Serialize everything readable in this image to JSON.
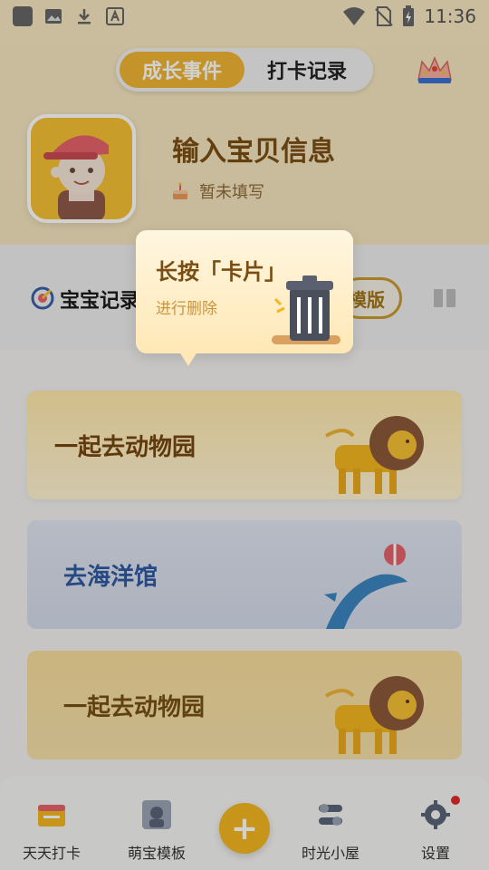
{
  "status_bar": {
    "time": "11:36",
    "icons": [
      "app-icon",
      "image-icon",
      "download-icon",
      "font-icon",
      "wifi-icon",
      "no-sim-icon",
      "battery-icon"
    ]
  },
  "header": {
    "tabs": [
      {
        "label": "成长事件",
        "active": true
      },
      {
        "label": "打卡记录",
        "active": false
      }
    ],
    "crown_icon": "crown-icon",
    "baby": {
      "name": "输入宝贝信息",
      "birthday_text": "暂未填写",
      "cake_icon": "cake-icon"
    }
  },
  "middle_bar": {
    "title": "宝宝记录",
    "pill_label": "模版",
    "icons": [
      "record-icon",
      "grid-icon"
    ]
  },
  "tooltip": {
    "title": "长按「卡片」",
    "subtitle": "进行删除",
    "icon": "trash-icon"
  },
  "cards": [
    {
      "label": "一起去动物园",
      "icon": "lion-icon",
      "color": "#fff4d2"
    },
    {
      "label": "去海洋馆",
      "icon": "dolphin-icon",
      "color": "#d3dae9"
    },
    {
      "label": "一起去动物园",
      "icon": "lion-icon",
      "color": "#f6e0a9"
    }
  ],
  "bottom_nav": {
    "items": [
      {
        "label": "天天打卡",
        "icon": "calendar-card-icon"
      },
      {
        "label": "萌宝模板",
        "icon": "baby-photo-icon"
      },
      {
        "label": "时光小屋",
        "icon": "toggles-icon"
      },
      {
        "label": "设置",
        "icon": "gear-icon"
      }
    ],
    "add_icon": "plus-icon"
  },
  "colors": {
    "accent": "#f2b620",
    "active_tab": "#f0b534",
    "header_bg": "#f6e7c0",
    "brown_text": "#7a4d14"
  }
}
